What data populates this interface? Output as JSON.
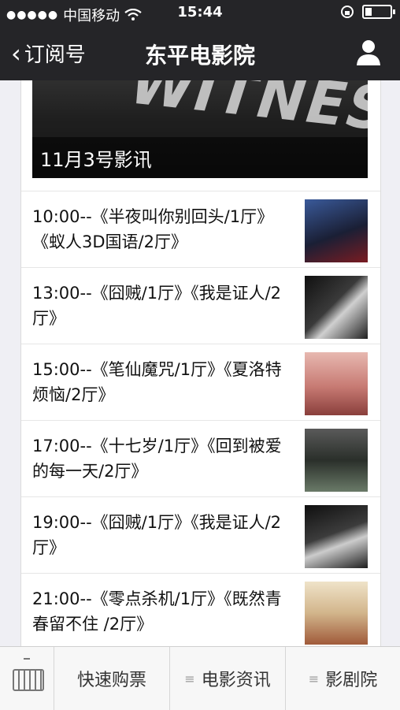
{
  "status_bar": {
    "carrier": "中国移动",
    "time": "15:44"
  },
  "nav": {
    "back_label": "订阅号",
    "title": "东平电影院"
  },
  "banner": {
    "caption": "11月3号影讯",
    "poster_text": "WITNESS"
  },
  "schedule": [
    {
      "text": "10:00--《半夜叫你别回头/1厅》《蚁人3D国语/2厅》",
      "poster_text": ""
    },
    {
      "text": "13:00--《囧贼/1厅》《我是证人/2厅》",
      "poster_text": ""
    },
    {
      "text": "15:00--《笔仙魔咒/1厅》《夏洛特烦恼/2厅》",
      "poster_text": ""
    },
    {
      "text": "17:00--《十七岁/1厅》《回到被爱的每一天/2厅》",
      "poster_text": ""
    },
    {
      "text": "19:00--《囧贼/1厅》《我是证人/2厅》",
      "poster_text": ""
    },
    {
      "text": "21:00--《零点杀机/1厅》《既然青春留不住 /2厅》",
      "poster_text": ""
    }
  ],
  "tabbar": {
    "tab1": "快速购票",
    "tab2": "电影资讯",
    "tab3": "影剧院"
  },
  "colors": {
    "header_bg": "#252528",
    "page_bg": "#efeff4"
  }
}
